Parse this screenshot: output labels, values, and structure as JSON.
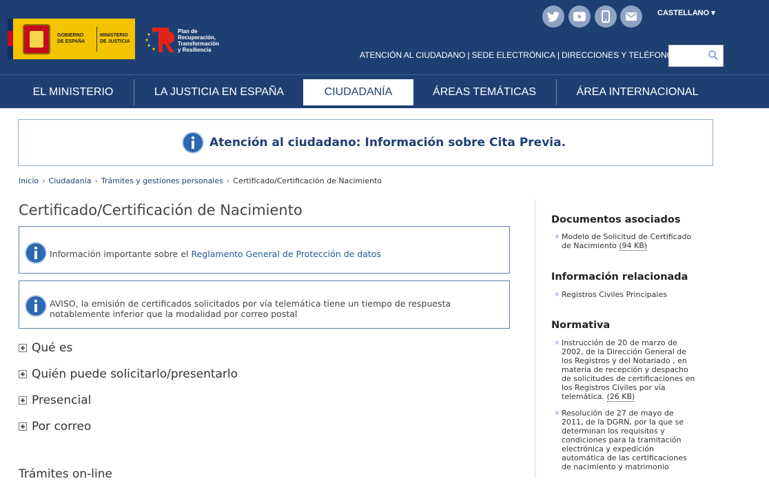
{
  "header": {
    "logo_gobierno": "GOBIERNO DE ESPAÑA",
    "logo_ministerio": "MINISTERIO DE JUSTICIA",
    "prtr_text": "Plan de Recuperación, Transformación y Resiliencia",
    "language": "CASTELLANO ▾",
    "social": [
      "twitter-icon",
      "youtube-icon",
      "mobile-icon",
      "mail-icon"
    ],
    "top_links": [
      "ATENCIÓN AL CIUDADANO",
      "SEDE ELECTRÓNICA",
      "DIRECCIONES Y TELÉFONOS"
    ],
    "search_placeholder": ""
  },
  "nav": {
    "items": [
      "EL MINISTERIO",
      "LA JUSTICIA EN ESPAÑA",
      "CIUDADANÍA",
      "ÁREAS TEMÁTICAS",
      "ÁREA INTERNACIONAL"
    ],
    "active": "CIUDADANÍA"
  },
  "notice": "Atención al ciudadano: Información sobre Cita Previa.",
  "breadcrumb": [
    "Inicio",
    "Ciudadanía",
    "Trámites y gestiones personales",
    "Certificado/Certificación de Nacimiento"
  ],
  "page_title": "Certificado/Certificación de Nacimiento",
  "info_boxes": {
    "privacy_prefix": "Información importante sobre el ",
    "privacy_link": "Reglamento General de Protección de datos",
    "aviso": "AVISO, la emisión de certificados solicitados por vía telemática tiene un tiempo de respuesta notablemente inferior que la modalidad por correo postal"
  },
  "accordion": [
    "Qué es",
    "Quién puede solicitarlo/presentarlo",
    "Presencial",
    "Por correo"
  ],
  "tramites_heading": "Trámites on-line",
  "sidebar": {
    "docs_heading": "Documentos asociados",
    "docs_item": "Modelo de Solicitud de Certificado de Nacimiento",
    "docs_size": "(94 KB)",
    "info_heading": "Información relacionada",
    "info_item": "Registros Civiles Principales",
    "normativa_heading": "Normativa",
    "norm_1": "Instrucción de 20 de marzo de 2002, de la Dirección General de los Registros y del Notariado , en materia de recepción y despacho de solicitudes de certificaciones en los Registros Civiles por vía telemática.",
    "norm_1_size": "(26 KB)",
    "norm_2": "Resolución de 27 de mayo de 2011, de la DGRN, por la que se determinan los requisitos y condiciones para la tramitación electrónica y expedición automática de las certificaciones de nacimiento y matrimonio"
  }
}
